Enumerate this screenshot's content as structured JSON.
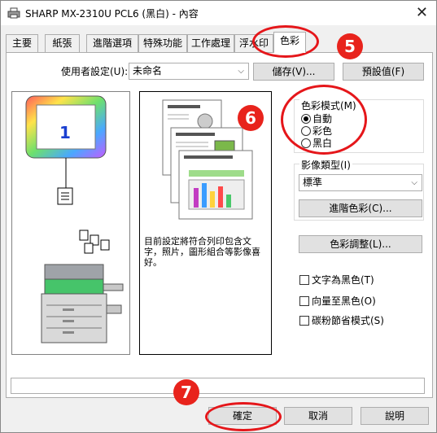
{
  "window": {
    "title": "SHARP MX-2310U PCL6 (黑白) - 內容",
    "close_icon": "close-icon"
  },
  "tabs": [
    {
      "label": "主要"
    },
    {
      "label": "紙張"
    },
    {
      "label": "進階選項"
    },
    {
      "label": "特殊功能"
    },
    {
      "label": "工作處理"
    },
    {
      "label": "浮水印"
    },
    {
      "label": "色彩"
    }
  ],
  "user_settings": {
    "label": "使用者設定(U):",
    "value": "未命名",
    "save_button": "儲存(V)...",
    "default_button": "預設值(F)"
  },
  "preview": {
    "copies_number": "1",
    "description": "目前設定將符合列印包含文字，照片，圖形組合等影像喜好。"
  },
  "color_mode": {
    "group_label": "色彩模式(M)",
    "options": [
      "自動",
      "彩色",
      "黑白"
    ],
    "selected": "自動"
  },
  "image_type": {
    "group_label": "影像類型(I)",
    "value": "標準",
    "advanced_button": "進階色彩(C)..."
  },
  "color_adjust_button": "色彩調整(L)...",
  "checkboxes": [
    {
      "label": "文字為黑色(T)",
      "checked": false
    },
    {
      "label": "向量至黑色(O)",
      "checked": false
    },
    {
      "label": "碳粉節省模式(S)",
      "checked": false
    }
  ],
  "footer": {
    "ok": "確定",
    "cancel": "取消",
    "help": "說明"
  },
  "callouts": {
    "c5": "5",
    "c6": "6",
    "c7": "7"
  },
  "colors": {
    "callout_red": "#e8231c",
    "ring_red": "#e5161a"
  }
}
